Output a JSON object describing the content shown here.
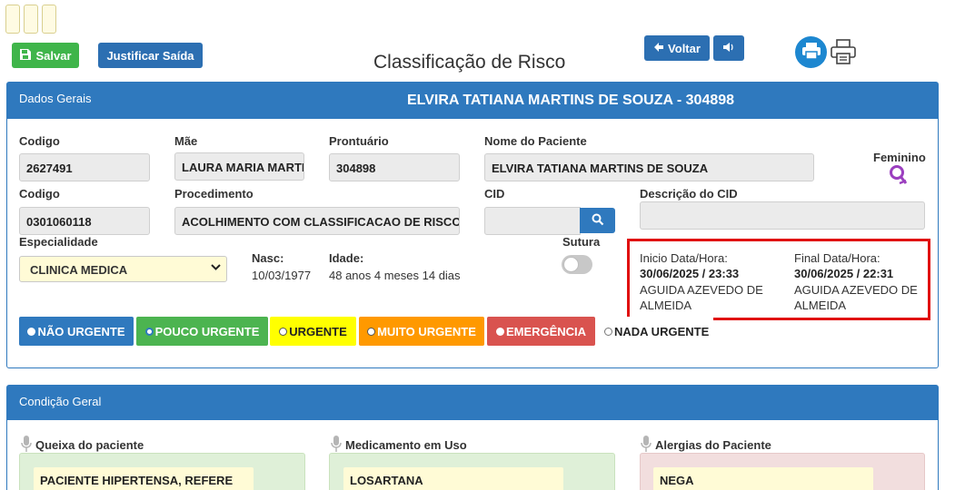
{
  "toolbar": {
    "save_label": "Salvar",
    "justify_label": "Justificar Saída",
    "back_label": "Voltar"
  },
  "page": {
    "title": "Classificação de Risco"
  },
  "general": {
    "section_title": "Dados Gerais",
    "patient_header": "ELVIRA TATIANA MARTINS DE SOUZA - 304898",
    "codigo_label": "Codigo",
    "codigo_value": "2627491",
    "mae_label": "Mãe",
    "mae_value": "LAURA MARIA  MARTINS",
    "prontuario_label": "Prontuário",
    "prontuario_value": "304898",
    "nome_label": "Nome do Paciente",
    "nome_value": "ELVIRA TATIANA MARTINS DE SOUZA",
    "sexo_label": "Feminino",
    "codigo2_label": "Codigo",
    "codigo2_value": "0301060118",
    "procedimento_label": "Procedimento",
    "procedimento_value": "ACOLHIMENTO COM CLASSIFICACAO DE RISCO",
    "cid_label": "CID",
    "cid_value": "",
    "descricao_cid_label": "Descrição do CID",
    "descricao_cid_value": "",
    "especialidade_label": "Especialidade",
    "especialidade_value": "CLINICA MEDICA",
    "nasc_label": "Nasc:",
    "nasc_value": "10/03/1977",
    "idade_label": "Idade:",
    "idade_value": "48 anos 4 meses 14 dias",
    "sutura_label": "Sutura",
    "inicio_label": "Inicio Data/Hora:",
    "inicio_value": "30/06/2025 / 23:33",
    "inicio_user": "AGUIDA AZEVEDO DE ALMEIDA",
    "final_label": "Final Data/Hora:",
    "final_value": "30/06/2025 / 22:31",
    "final_user": "AGUIDA AZEVEDO DE ALMEIDA"
  },
  "risk_levels": [
    {
      "label": "NÃO URGENTE",
      "color": "#2f79be"
    },
    {
      "label": "POUCO URGENTE",
      "color": "#4cb450"
    },
    {
      "label": "URGENTE",
      "color": "#ffff00"
    },
    {
      "label": "MUITO URGENTE",
      "color": "#ff9900"
    },
    {
      "label": "EMERGÊNCIA",
      "color": "#d9534f"
    },
    {
      "label": "NADA URGENTE",
      "color": "#ffffff"
    }
  ],
  "condition": {
    "section_title": "Condição Geral",
    "queixa_label": "Queixa do paciente",
    "queixa_value": "PACIENTE HIPERTENSA, REFERE",
    "medicamento_label": "Medicamento em Uso",
    "medicamento_value": "LOSARTANA",
    "alergias_label": "Alergias do Paciente",
    "alergias_value": "NEGA"
  },
  "icons": [
    "save-icon",
    "back-arrow-icon",
    "speaker-icon",
    "printer-icon",
    "search-icon",
    "female-icon",
    "microphone-icon",
    "chevron-down-icon"
  ]
}
